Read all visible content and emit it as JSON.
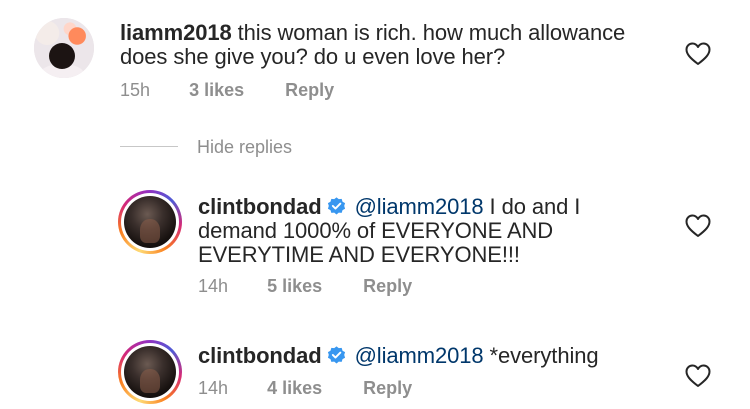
{
  "thread": {
    "parent": {
      "username": "liamm2018",
      "text": "this woman is rich. how much allowance does she give you? do u even love her?",
      "time": "15h",
      "likes": "3 likes",
      "reply": "Reply"
    },
    "hide_replies": "Hide replies",
    "replies": [
      {
        "username": "clintbondad",
        "mention": "@liamm2018",
        "text": "I do and I demand 1000% of EVERYONE AND EVERYTIME AND EVERYONE!!!",
        "time": "14h",
        "likes": "5 likes",
        "reply": "Reply"
      },
      {
        "username": "clintbondad",
        "mention": "@liamm2018",
        "text": "*everything",
        "time": "14h",
        "likes": "4 likes",
        "reply": "Reply"
      }
    ]
  },
  "icons": {
    "verified": "verified-badge-icon",
    "like": "heart-icon"
  },
  "colors": {
    "verified_blue": "#3897f0",
    "meta_gray": "#8e8e8e",
    "mention_blue": "#00376b",
    "text": "#262626"
  }
}
